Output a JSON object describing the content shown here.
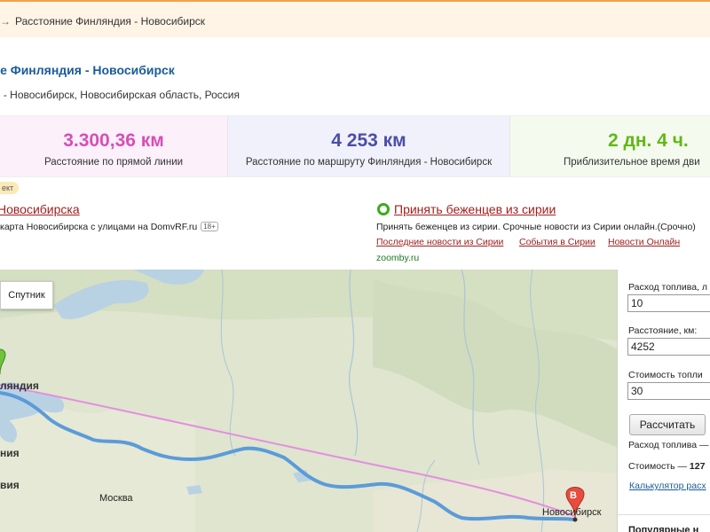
{
  "breadcrumb": {
    "text": "Расстояние Финляндия - Новосибирск"
  },
  "title": "ние Финляндия - Новосибирск",
  "subtitle": "я - Новосибирск, Новосибирская область, Россия",
  "stats": [
    {
      "value": "3.300,36 км",
      "label": "Расстояние по прямой линии",
      "color": "#d64fb7"
    },
    {
      "value": "4 253 км",
      "label": "Расстояние по маршруту Финляндия - Новосибирск",
      "color": "#4c4ea8"
    },
    {
      "value": "2 дн. 4 ч.",
      "label": "Приблизительное время дви",
      "color": "#61b817"
    }
  ],
  "ads": {
    "badge": "ект",
    "left": {
      "title": "Новосибирска",
      "text": "карта Новосибирска с улицами на DomvRF.ru",
      "age": "18+"
    },
    "right": {
      "title": "Принять беженцев из сирии",
      "text": "Принять беженцев из сирии. Срочные новости из Сирии онлайн.(Срочно)",
      "links": [
        "Последние новости из Сирии",
        "События в Сирии",
        "Новости Онлайн"
      ],
      "domain": "zoomby.ru"
    }
  },
  "map": {
    "satellite_label": "Спутник",
    "labels": {
      "finland": "ляндия",
      "moscow": "Москва",
      "novosibirsk": "Новосибирск",
      "left_mid": "ния",
      "left_low": "вия"
    },
    "marker_a": "",
    "marker_b": "B"
  },
  "calculator": {
    "fuel_consumption_label": "Расход топлива, л",
    "fuel_consumption_value": "10",
    "distance_label": "Расстояние, км:",
    "distance_value": "4252",
    "fuel_cost_label": "Стоимость топли",
    "fuel_cost_value": "30",
    "button": "Рассчитать",
    "result_fuel": "Расход топлива —",
    "result_cost_label": "Стоимость —",
    "result_cost_value": "127",
    "link": "Калькулятор расх",
    "more": "Популярные н"
  }
}
